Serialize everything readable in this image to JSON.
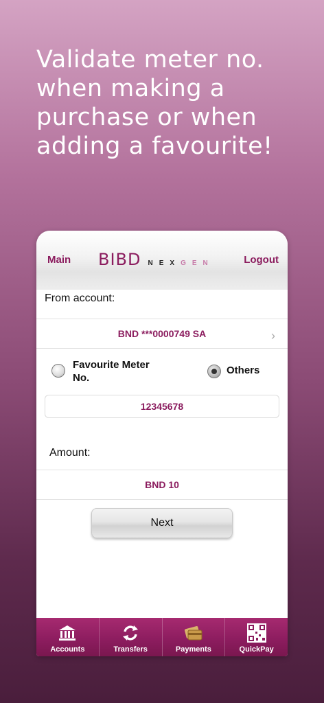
{
  "headline": {
    "lines": [
      "Validate meter no.",
      "when making a",
      "purchase or when",
      "adding a favourite!"
    ]
  },
  "topbar": {
    "main_label": "Main",
    "brand": "BIBD",
    "brand_nex": "NEX",
    "brand_gen": "GEN",
    "logout_label": "Logout"
  },
  "form": {
    "from_label": "From account:",
    "account_value": "BND ***0000749 SA",
    "radio_favourite_label_1": "Favourite Meter",
    "radio_favourite_label_2": "No.",
    "radio_others_label": "Others",
    "selected_option": "Others",
    "meter_value": "12345678",
    "amount_label": "Amount:",
    "amount_value": "BND 10",
    "next_label": "Next"
  },
  "tabs": [
    {
      "label": "Accounts",
      "icon": "bank-icon"
    },
    {
      "label": "Transfers",
      "icon": "transfer-arrows-icon"
    },
    {
      "label": "Payments",
      "icon": "cards-icon"
    },
    {
      "label": "QuickPay",
      "icon": "qr-code-icon"
    }
  ],
  "colors": {
    "brand": "#8b1c5e",
    "accent_light": "#c77aa8"
  }
}
